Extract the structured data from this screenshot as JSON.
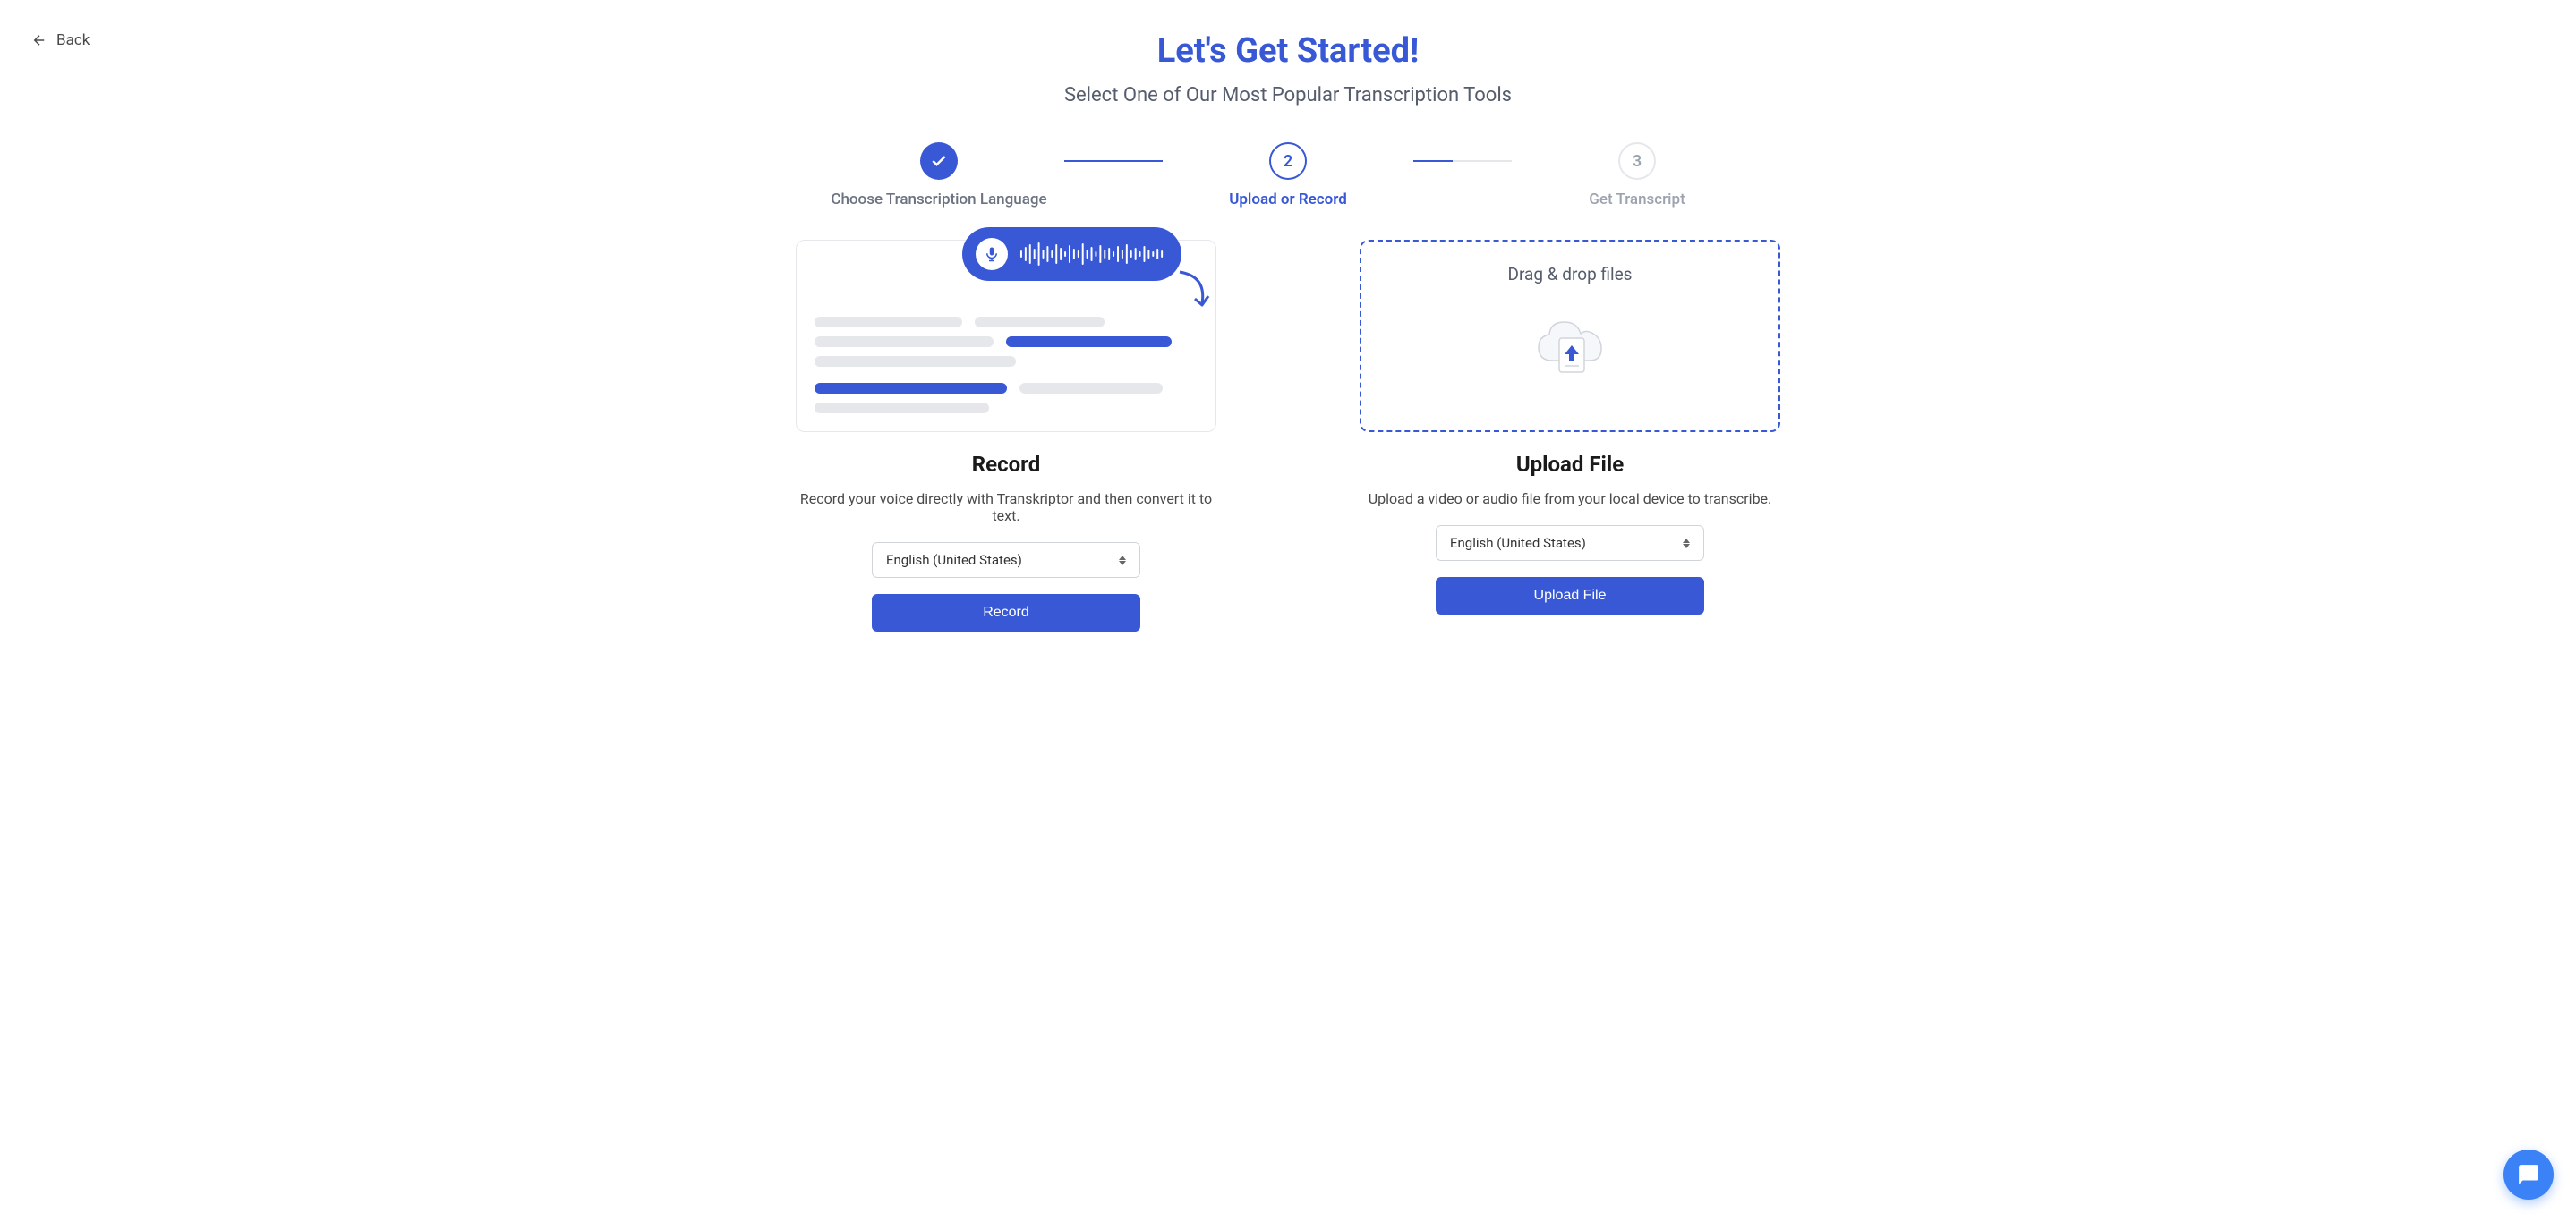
{
  "nav": {
    "back_label": "Back"
  },
  "header": {
    "title": "Let's Get Started!",
    "subtitle": "Select One of Our Most Popular Transcription Tools"
  },
  "stepper": {
    "step1": {
      "label": "Choose Transcription Language"
    },
    "step2": {
      "number": "2",
      "label": "Upload or Record"
    },
    "step3": {
      "number": "3",
      "label": "Get Transcript"
    }
  },
  "record": {
    "title": "Record",
    "description": "Record your voice directly with Transkriptor and then convert it to text.",
    "language_selected": "English (United States)",
    "button_label": "Record"
  },
  "upload": {
    "dropzone_text": "Drag & drop files",
    "title": "Upload File",
    "description": "Upload a video or audio file from your local device to transcribe.",
    "language_selected": "English (United States)",
    "button_label": "Upload File"
  },
  "colors": {
    "primary": "#3858d6",
    "muted": "#6b7280",
    "text": "#1a1a1a"
  }
}
